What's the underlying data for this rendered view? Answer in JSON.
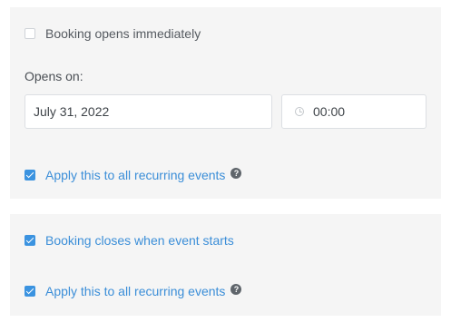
{
  "opening": {
    "immediate_label": "Booking opens immediately",
    "immediate_checked": false,
    "opens_on_label": "Opens on:",
    "date_value": "July 31, 2022",
    "time_value": "00:00",
    "apply_label": "Apply this to all recurring events",
    "apply_checked": true,
    "help_glyph": "?"
  },
  "closing": {
    "closes_label": "Booking closes when event starts",
    "closes_checked": true,
    "apply_label": "Apply this to all recurring events",
    "apply_checked": true,
    "help_glyph": "?"
  },
  "colors": {
    "accent": "#3b93e0",
    "panel_bg": "#f5f5f5"
  },
  "icons": [
    "checkbox-icon",
    "clock-icon",
    "help-icon"
  ]
}
